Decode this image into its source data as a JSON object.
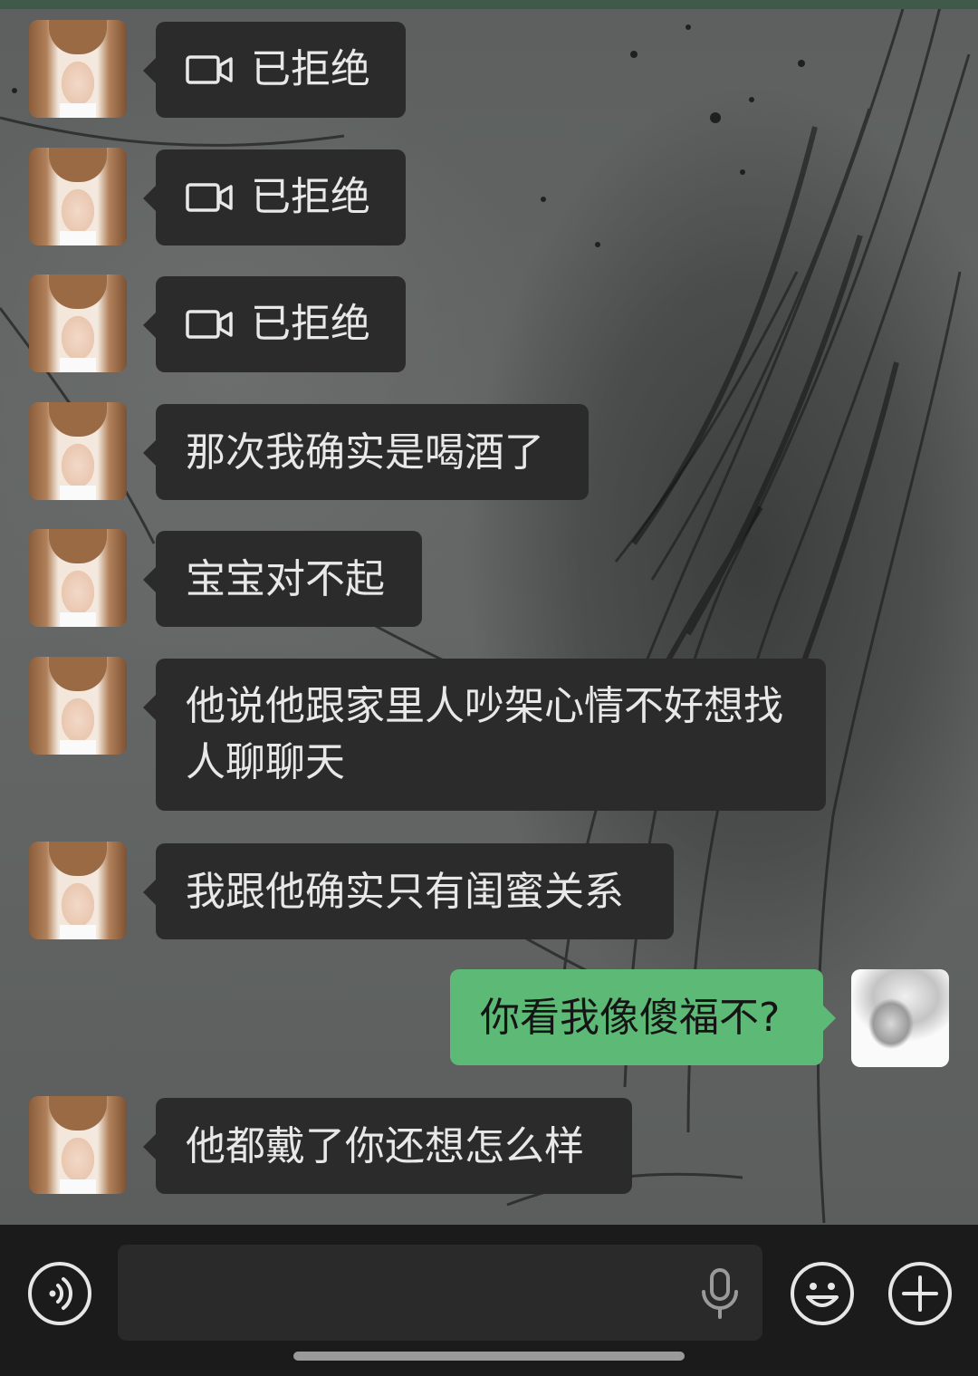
{
  "messages": [
    {
      "side": "in",
      "type": "video-call",
      "text": "已拒绝",
      "icon": "video-camera-icon"
    },
    {
      "side": "in",
      "type": "video-call",
      "text": "已拒绝",
      "icon": "video-camera-icon"
    },
    {
      "side": "in",
      "type": "video-call",
      "text": "已拒绝",
      "icon": "video-camera-icon"
    },
    {
      "side": "in",
      "type": "text",
      "text": "那次我确实是喝酒了"
    },
    {
      "side": "in",
      "type": "text",
      "text": "宝宝对不起"
    },
    {
      "side": "in",
      "type": "text",
      "lines": [
        "他说他跟家里人吵架心情不好想找",
        "人聊聊天"
      ]
    },
    {
      "side": "in",
      "type": "text",
      "text": "我跟他确实只有闺蜜关系"
    },
    {
      "side": "out",
      "type": "text",
      "text": "你看我像傻福不?"
    },
    {
      "side": "in",
      "type": "text",
      "text": "他都戴了你还想怎么样"
    }
  ],
  "input_bar": {
    "input_value": "",
    "icons": [
      "voice-mode-icon",
      "microphone-icon",
      "emoji-icon",
      "plus-icon"
    ]
  },
  "colors": {
    "incoming_bubble": "#2b2b2b",
    "outgoing_bubble": "#5dba76",
    "input_bar": "#1b1b1b"
  }
}
